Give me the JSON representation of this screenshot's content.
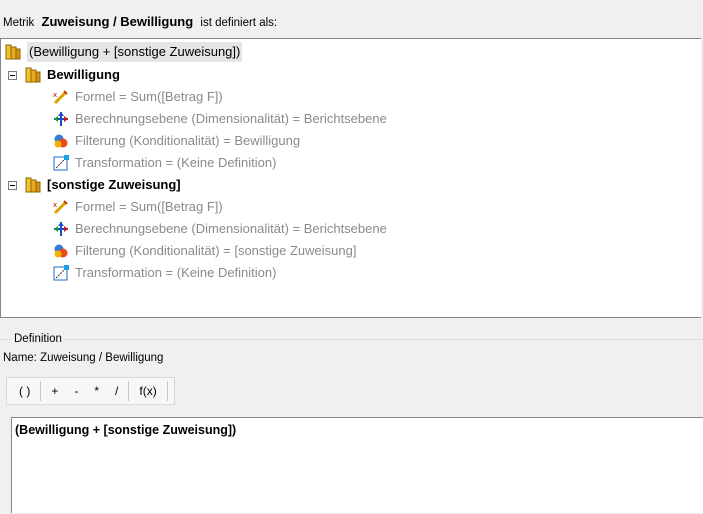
{
  "header": {
    "prefix": "Metrik",
    "metric_name": "Zuweisung / Bewilligung",
    "suffix": "ist definiert als:"
  },
  "tree": {
    "root": {
      "label": "(Bewilligung + [sonstige Zuweisung])",
      "icon": "metric-icon"
    },
    "groups": [
      {
        "label": "Bewilligung",
        "icon": "metric-icon",
        "children": [
          {
            "label": "Formel = Sum([Betrag F])",
            "icon": "formula-icon"
          },
          {
            "label": "Berechnungsebene (Dimensionalität) = Berichtsebene",
            "icon": "level-icon"
          },
          {
            "label": "Filterung (Konditionalität) = Bewilligung",
            "icon": "filter-icon"
          },
          {
            "label": "Transformation = (Keine Definition)",
            "icon": "transformation-icon"
          }
        ]
      },
      {
        "label": "[sonstige Zuweisung]",
        "icon": "metric-icon",
        "children": [
          {
            "label": "Formel = Sum([Betrag F])",
            "icon": "formula-icon"
          },
          {
            "label": "Berechnungsebene (Dimensionalität) = Berichtsebene",
            "icon": "level-icon"
          },
          {
            "label": "Filterung (Konditionalität) = [sonstige Zuweisung]",
            "icon": "filter-icon"
          },
          {
            "label": "Transformation = (Keine Definition)",
            "icon": "transformation-icon"
          }
        ]
      }
    ]
  },
  "definition": {
    "legend": "Definition",
    "name_label": "Name:",
    "name_value": "Zuweisung / Bewilligung",
    "toolbar": [
      "( )",
      "+",
      "-",
      "*",
      "/",
      "f(x)"
    ],
    "formula": "(Bewilligung + [sonstige Zuweisung])"
  }
}
